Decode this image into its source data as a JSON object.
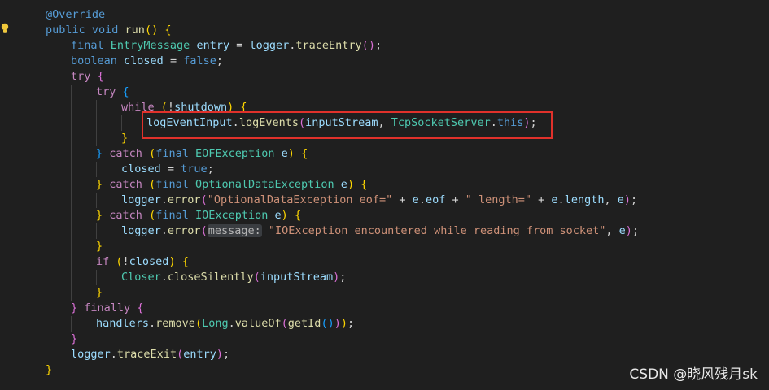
{
  "lines": [
    {
      "tokens": [
        {
          "c": "a",
          "t": "@Override"
        }
      ]
    },
    {
      "tokens": [
        {
          "c": "k",
          "t": "public "
        },
        {
          "c": "k",
          "t": "void "
        },
        {
          "c": "f",
          "t": "run"
        },
        {
          "c": "y",
          "t": "()"
        },
        {
          "c": "p",
          "t": " "
        },
        {
          "c": "y",
          "t": "{"
        }
      ]
    },
    {
      "tokens": [
        {
          "c": "k",
          "t": "final "
        },
        {
          "c": "t",
          "t": "EntryMessage "
        },
        {
          "c": "v",
          "t": "entry"
        },
        {
          "c": "p",
          "t": " = "
        },
        {
          "c": "v",
          "t": "logger"
        },
        {
          "c": "p",
          "t": "."
        },
        {
          "c": "f",
          "t": "traceEntry"
        },
        {
          "c": "m",
          "t": "()"
        },
        {
          "c": "p",
          "t": ";"
        }
      ]
    },
    {
      "tokens": [
        {
          "c": "k",
          "t": "boolean "
        },
        {
          "c": "v",
          "t": "closed"
        },
        {
          "c": "p",
          "t": " = "
        },
        {
          "c": "k",
          "t": "false"
        },
        {
          "c": "p",
          "t": ";"
        }
      ]
    },
    {
      "tokens": [
        {
          "c": "c",
          "t": "try "
        },
        {
          "c": "m",
          "t": "{"
        }
      ]
    },
    {
      "tokens": [
        {
          "c": "c",
          "t": "try "
        },
        {
          "c": "b",
          "t": "{"
        }
      ]
    },
    {
      "tokens": [
        {
          "c": "c",
          "t": "while "
        },
        {
          "c": "y",
          "t": "("
        },
        {
          "c": "p",
          "t": "!"
        },
        {
          "c": "v",
          "t": "shutdown"
        },
        {
          "c": "y",
          "t": ")"
        },
        {
          "c": "p",
          "t": " "
        },
        {
          "c": "y",
          "t": "{"
        }
      ]
    },
    {
      "tokens": [
        {
          "c": "v",
          "t": "logEventInput"
        },
        {
          "c": "p",
          "t": "."
        },
        {
          "c": "f",
          "t": "logEvents"
        },
        {
          "c": "m",
          "t": "("
        },
        {
          "c": "v",
          "t": "inputStream"
        },
        {
          "c": "p",
          "t": ", "
        },
        {
          "c": "t",
          "t": "TcpSocketServer"
        },
        {
          "c": "p",
          "t": "."
        },
        {
          "c": "k",
          "t": "this"
        },
        {
          "c": "m",
          "t": ")"
        },
        {
          "c": "p",
          "t": ";"
        }
      ]
    },
    {
      "tokens": [
        {
          "c": "y",
          "t": "}"
        }
      ]
    },
    {
      "tokens": [
        {
          "c": "b",
          "t": "}"
        },
        {
          "c": "p",
          "t": " "
        },
        {
          "c": "c",
          "t": "catch "
        },
        {
          "c": "y",
          "t": "("
        },
        {
          "c": "k",
          "t": "final "
        },
        {
          "c": "t",
          "t": "EOFException "
        },
        {
          "c": "v",
          "t": "e"
        },
        {
          "c": "y",
          "t": ")"
        },
        {
          "c": "p",
          "t": " "
        },
        {
          "c": "y",
          "t": "{"
        }
      ]
    },
    {
      "tokens": [
        {
          "c": "v",
          "t": "closed"
        },
        {
          "c": "p",
          "t": " = "
        },
        {
          "c": "k",
          "t": "true"
        },
        {
          "c": "p",
          "t": ";"
        }
      ]
    },
    {
      "tokens": [
        {
          "c": "y",
          "t": "}"
        },
        {
          "c": "p",
          "t": " "
        },
        {
          "c": "c",
          "t": "catch "
        },
        {
          "c": "y",
          "t": "("
        },
        {
          "c": "k",
          "t": "final "
        },
        {
          "c": "t",
          "t": "OptionalDataException "
        },
        {
          "c": "v",
          "t": "e"
        },
        {
          "c": "y",
          "t": ")"
        },
        {
          "c": "p",
          "t": " "
        },
        {
          "c": "y",
          "t": "{"
        }
      ]
    },
    {
      "tokens": [
        {
          "c": "v",
          "t": "logger"
        },
        {
          "c": "p",
          "t": "."
        },
        {
          "c": "f",
          "t": "error"
        },
        {
          "c": "m",
          "t": "("
        },
        {
          "c": "s",
          "t": "\"OptionalDataException eof=\""
        },
        {
          "c": "p",
          "t": " + "
        },
        {
          "c": "v",
          "t": "e"
        },
        {
          "c": "p",
          "t": "."
        },
        {
          "c": "v",
          "t": "eof"
        },
        {
          "c": "p",
          "t": " + "
        },
        {
          "c": "s",
          "t": "\" length=\""
        },
        {
          "c": "p",
          "t": " + "
        },
        {
          "c": "v",
          "t": "e"
        },
        {
          "c": "p",
          "t": "."
        },
        {
          "c": "v",
          "t": "length"
        },
        {
          "c": "p",
          "t": ", "
        },
        {
          "c": "v",
          "t": "e"
        },
        {
          "c": "m",
          "t": ")"
        },
        {
          "c": "p",
          "t": ";"
        }
      ]
    },
    {
      "tokens": [
        {
          "c": "y",
          "t": "}"
        },
        {
          "c": "p",
          "t": " "
        },
        {
          "c": "c",
          "t": "catch "
        },
        {
          "c": "y",
          "t": "("
        },
        {
          "c": "k",
          "t": "final "
        },
        {
          "c": "t",
          "t": "IOException "
        },
        {
          "c": "v",
          "t": "e"
        },
        {
          "c": "y",
          "t": ")"
        },
        {
          "c": "p",
          "t": " "
        },
        {
          "c": "y",
          "t": "{"
        }
      ]
    },
    {
      "tokens": [
        {
          "c": "v",
          "t": "logger"
        },
        {
          "c": "p",
          "t": "."
        },
        {
          "c": "f",
          "t": "error"
        },
        {
          "c": "m",
          "t": "("
        },
        {
          "c": "hint",
          "t": "message:"
        },
        {
          "c": "p",
          "t": " "
        },
        {
          "c": "s",
          "t": "\"IOException encountered while reading from socket\""
        },
        {
          "c": "p",
          "t": ", "
        },
        {
          "c": "v",
          "t": "e"
        },
        {
          "c": "m",
          "t": ")"
        },
        {
          "c": "p",
          "t": ";"
        }
      ]
    },
    {
      "tokens": [
        {
          "c": "y",
          "t": "}"
        }
      ]
    },
    {
      "tokens": [
        {
          "c": "c",
          "t": "if "
        },
        {
          "c": "y",
          "t": "("
        },
        {
          "c": "p",
          "t": "!"
        },
        {
          "c": "v",
          "t": "closed"
        },
        {
          "c": "y",
          "t": ")"
        },
        {
          "c": "p",
          "t": " "
        },
        {
          "c": "y",
          "t": "{"
        }
      ]
    },
    {
      "tokens": [
        {
          "c": "t",
          "t": "Closer"
        },
        {
          "c": "p",
          "t": "."
        },
        {
          "c": "f",
          "t": "closeSilently"
        },
        {
          "c": "m",
          "t": "("
        },
        {
          "c": "v",
          "t": "inputStream"
        },
        {
          "c": "m",
          "t": ")"
        },
        {
          "c": "p",
          "t": ";"
        }
      ]
    },
    {
      "tokens": [
        {
          "c": "y",
          "t": "}"
        }
      ]
    },
    {
      "tokens": [
        {
          "c": "m",
          "t": "}"
        },
        {
          "c": "p",
          "t": " "
        },
        {
          "c": "c",
          "t": "finally "
        },
        {
          "c": "m",
          "t": "{"
        }
      ]
    },
    {
      "tokens": [
        {
          "c": "v",
          "t": "handlers"
        },
        {
          "c": "p",
          "t": "."
        },
        {
          "c": "f",
          "t": "remove"
        },
        {
          "c": "y",
          "t": "("
        },
        {
          "c": "t",
          "t": "Long"
        },
        {
          "c": "p",
          "t": "."
        },
        {
          "c": "f",
          "t": "valueOf"
        },
        {
          "c": "m",
          "t": "("
        },
        {
          "c": "f",
          "t": "getId"
        },
        {
          "c": "b",
          "t": "()"
        },
        {
          "c": "m",
          "t": ")"
        },
        {
          "c": "y",
          "t": ")"
        },
        {
          "c": "p",
          "t": ";"
        }
      ]
    },
    {
      "tokens": [
        {
          "c": "m",
          "t": "}"
        }
      ]
    },
    {
      "tokens": [
        {
          "c": "v",
          "t": "logger"
        },
        {
          "c": "p",
          "t": "."
        },
        {
          "c": "f",
          "t": "traceExit"
        },
        {
          "c": "m",
          "t": "("
        },
        {
          "c": "v",
          "t": "entry"
        },
        {
          "c": "m",
          "t": ")"
        },
        {
          "c": "p",
          "t": ";"
        }
      ]
    },
    {
      "tokens": [
        {
          "c": "y",
          "t": "}"
        }
      ]
    }
  ],
  "watermark": "CSDN @晓风残月sk",
  "colors": {
    "background": "#1f1f1f",
    "highlight_box": "#e0312b"
  },
  "gutter_icon": "lightbulb-icon"
}
